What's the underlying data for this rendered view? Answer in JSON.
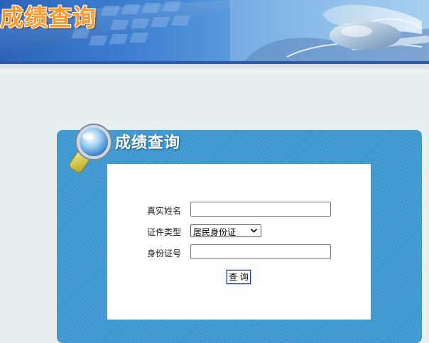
{
  "banner": {
    "title": "成绩查询"
  },
  "panel": {
    "title": "成绩查询"
  },
  "form": {
    "name_label": "真实姓名",
    "name_value": "",
    "id_type_label": "证件类型",
    "id_type_selected": "居民身份证",
    "id_number_label": "身份证号",
    "id_number_value": "",
    "submit_label": "查 询"
  },
  "colors": {
    "banner_title": "#ff9a2a",
    "panel_bg": "#3d98cf",
    "page_bg": "#e8eff1",
    "button_border": "#1f3f8a"
  },
  "icons": [
    "keyboard-image",
    "mouse-image",
    "magnifier-icon",
    "dropdown-arrow-icon"
  ]
}
